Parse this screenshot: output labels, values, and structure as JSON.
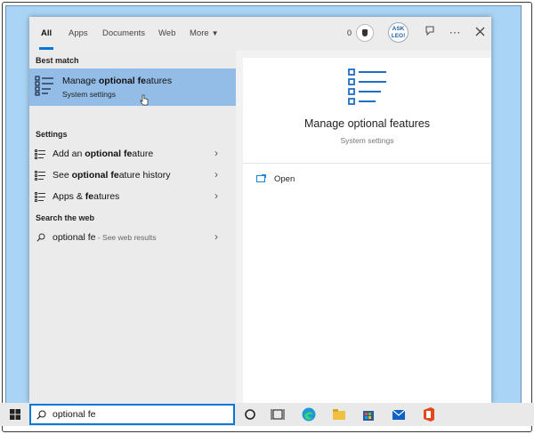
{
  "tabs": [
    {
      "label": "All",
      "active": true
    },
    {
      "label": "Apps"
    },
    {
      "label": "Documents"
    },
    {
      "label": "Web"
    },
    {
      "label": "More",
      "icon": "chevron-down-icon"
    }
  ],
  "header": {
    "rewards_count": "0",
    "avatar_text": "ASK LEO!",
    "icons": [
      "trophy-icon",
      "avatar",
      "feedback-icon",
      "more-options-icon",
      "close-icon"
    ]
  },
  "sections": {
    "best_match": "Best match",
    "settings": "Settings",
    "search_web": "Search the web"
  },
  "best_match": {
    "title_pre": "Manage ",
    "title_bold": "optional fe",
    "title_post": "atures",
    "subtitle": "System settings",
    "icon": "list-settings-icon"
  },
  "settings_results": [
    {
      "pre": "Add an ",
      "bold": "optional fe",
      "post": "ature"
    },
    {
      "pre": "See ",
      "bold": "optional fe",
      "post": "ature history"
    },
    {
      "pre": "Apps & ",
      "bold": "fe",
      "post": "atures"
    }
  ],
  "web_result": {
    "query": "optional fe",
    "suffix": " - See web results"
  },
  "preview": {
    "title": "Manage optional features",
    "subtitle": "System settings",
    "action_label": "Open"
  },
  "taskbar": {
    "search_value": "optional fe",
    "icons": [
      "windows-start-icon",
      "cortana-icon",
      "task-view-icon",
      "edge-icon",
      "file-explorer-icon",
      "store-icon",
      "mail-icon",
      "office-icon"
    ]
  },
  "colors": {
    "accent": "#0078d4",
    "selected_row": "#93bde6",
    "background": "#a9d4f5"
  }
}
